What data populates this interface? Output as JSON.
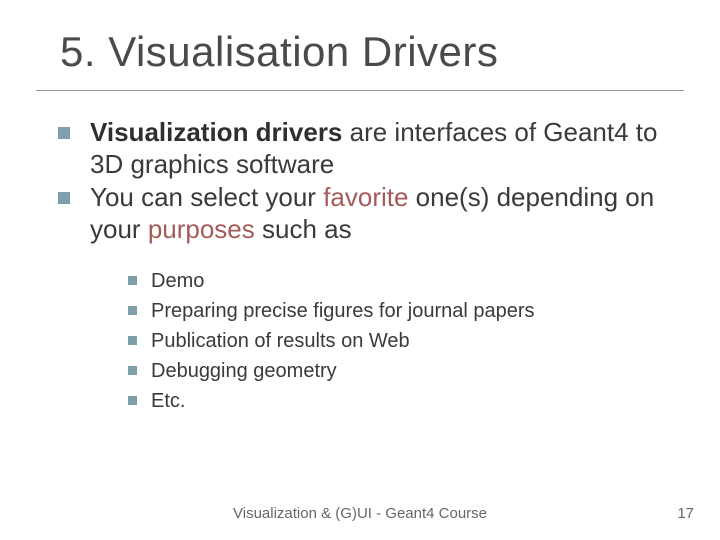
{
  "title": "5. Visualisation Drivers",
  "bullets": [
    {
      "prefix_bold": "Visualization drivers",
      "rest": " are interfaces of Geant4 to 3D graphics software"
    },
    {
      "pre": "You can select your ",
      "accent1": "favorite",
      "mid": " one(s) depending on your ",
      "accent2": "purposes",
      "post": " such as"
    }
  ],
  "sub_bullets": [
    "Demo",
    "Preparing precise figures for journal papers",
    "Publication of results on Web",
    "Debugging geometry",
    "Etc."
  ],
  "footer": "Visualization & (G)UI - Geant4 Course",
  "page_number": "17"
}
